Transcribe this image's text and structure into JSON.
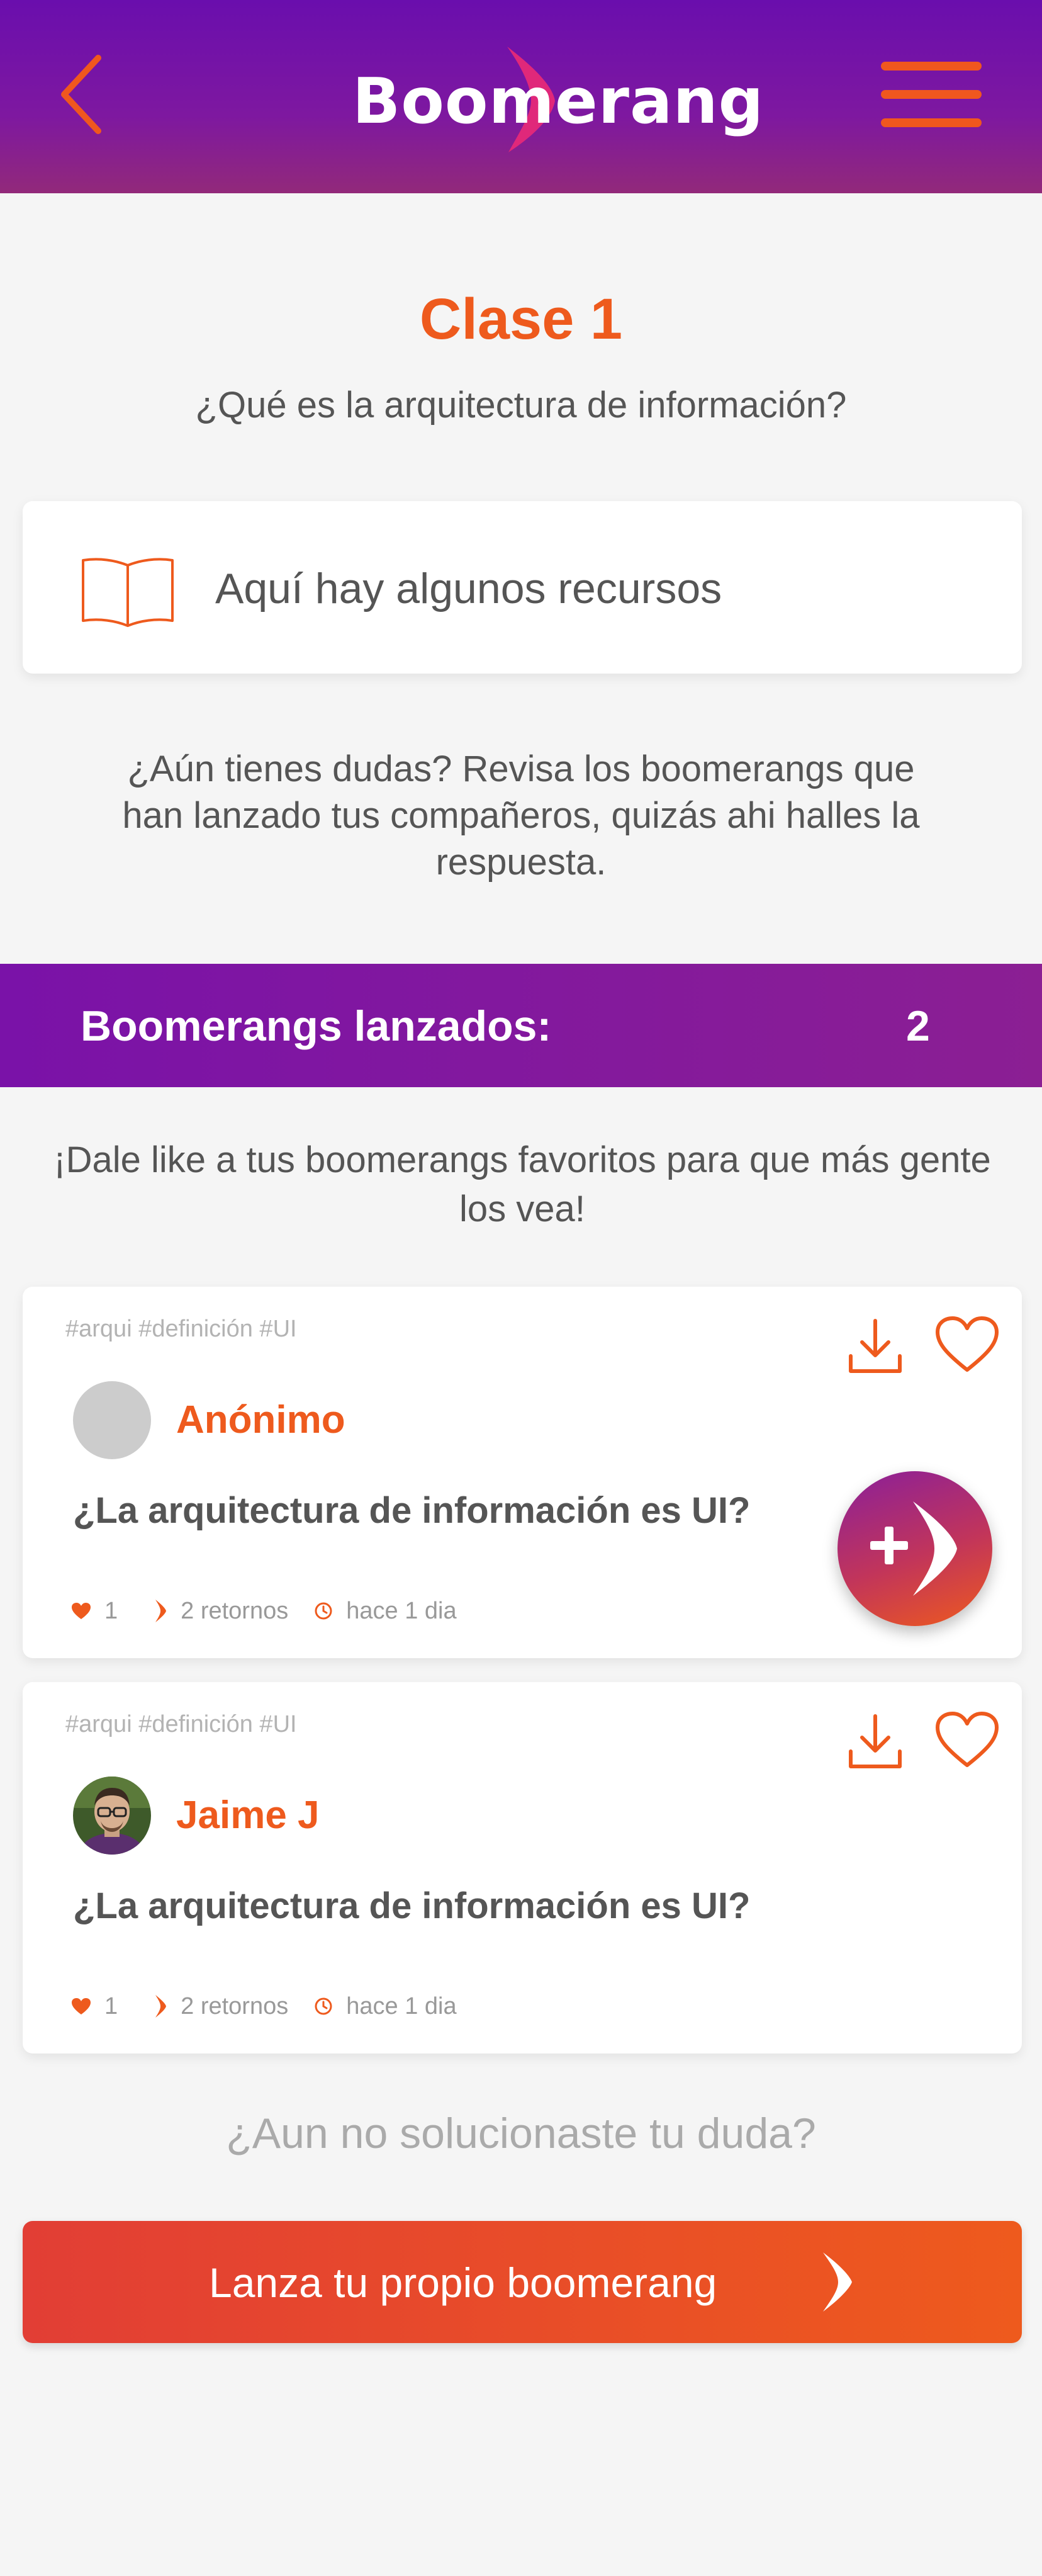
{
  "header": {
    "logo_text": "Boomerang",
    "back_icon": "chevron-left-icon",
    "menu_icon": "hamburger-menu-icon"
  },
  "lesson": {
    "title": "Clase 1",
    "subtitle": "¿Qué es la arquitectura de información?",
    "resources_label": "Aquí hay algunos recursos",
    "resources_icon": "book-icon"
  },
  "doubts_text": "¿Aún tienes dudas? Revisa los boomerangs que han lanzado tus compañeros, quizás ahi halles la respuesta.",
  "launched": {
    "label": "Boomerangs lanzados:",
    "count": "2"
  },
  "like_prompt": "¡Dale like a tus boomerangs favoritos para que más gente los vea!",
  "posts": [
    {
      "tags": "#arqui #definición #UI",
      "author": "Anónimo",
      "avatar": "blank",
      "question": "¿La arquitectura de información es UI?",
      "likes": "1",
      "returns": "2 retornos",
      "time": "hace 1 dia"
    },
    {
      "tags": "#arqui #definición #UI",
      "author": "Jaime J",
      "avatar": "photo",
      "question": "¿La arquitectura de información es UI?",
      "likes": "1",
      "returns": "2 retornos",
      "time": "hace 1 dia"
    }
  ],
  "footer": {
    "not_solved": "¿Aun no solucionaste tu duda?",
    "launch_button": "Lanza tu propio boomerang"
  },
  "colors": {
    "accent": "#ee5a1d",
    "purple": "#7a12a8",
    "text": "#555555"
  }
}
